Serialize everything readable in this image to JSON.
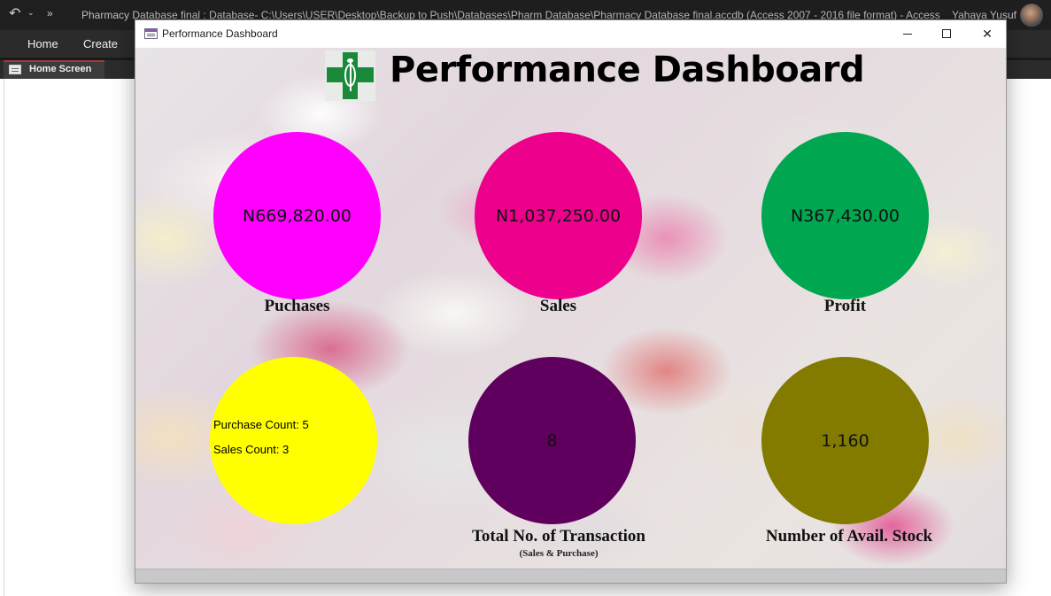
{
  "app": {
    "title": "Pharmacy Database final : Database- C:\\Users\\USER\\Desktop\\Backup to Push\\Databases\\Pharm Database\\Pharmacy Database final.accdb (Access 2007 - 2016 file format)  -  Access",
    "user_name": "Yahaya Yusuf",
    "quick_access": {
      "more_label": "»"
    }
  },
  "ribbon": {
    "tabs": [
      "Home",
      "Create"
    ]
  },
  "object_tabs": [
    {
      "label": "Home Screen"
    }
  ],
  "popup": {
    "title": "Performance Dashboard"
  },
  "dashboard": {
    "heading": "Performance Dashboard",
    "tiles": {
      "purchases": {
        "value": "N669,820.00",
        "label": "Puchases",
        "color": "#ff00ff"
      },
      "sales": {
        "value": "N1,037,250.00",
        "label": "Sales",
        "color": "#ec008c"
      },
      "profit": {
        "value": "N367,430.00",
        "label": "Profit",
        "color": "#00a650"
      },
      "counts": {
        "purchase_count": "Purchase Count: 5",
        "sales_count": "Sales Count: 3",
        "color": "#ffff00"
      },
      "transactions": {
        "value": "8",
        "label": "Total No. of Transaction",
        "sublabel": "(Sales & Purchase)",
        "color": "#5f005f"
      },
      "stock": {
        "value": "1,160",
        "label": "Number of Avail. Stock",
        "color": "#827b00"
      }
    }
  }
}
